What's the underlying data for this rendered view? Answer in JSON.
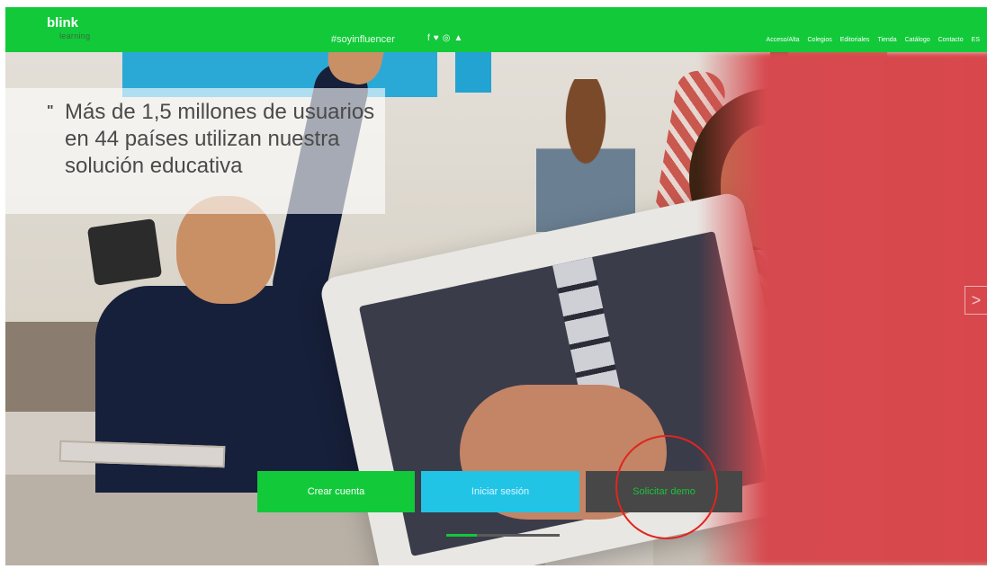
{
  "nav": {
    "logo": "blink",
    "logo_sub": "learning",
    "hashtag": "#soyinfluencer",
    "social_icons": [
      "facebook-icon",
      "twitter-icon",
      "instagram-icon",
      "linkedin-icon"
    ],
    "menu": [
      "Acceso/Alta",
      "Colegios",
      "Editoriales",
      "Tienda",
      "Catálogo",
      "Contacto",
      "ES"
    ]
  },
  "hero": {
    "quote": "Más de 1,5 millones de usuarios en 44 países utilizan nuestra solución educativa",
    "buttons": {
      "create": "Crear cuenta",
      "login": "Iniciar sesión",
      "request": "Solicitar demo"
    },
    "next_arrow": ">"
  },
  "colors": {
    "brand_green": "#12c93a",
    "login_blue": "#22c4e6",
    "dark_button": "#474747",
    "highlight_red": "#e0251f"
  }
}
